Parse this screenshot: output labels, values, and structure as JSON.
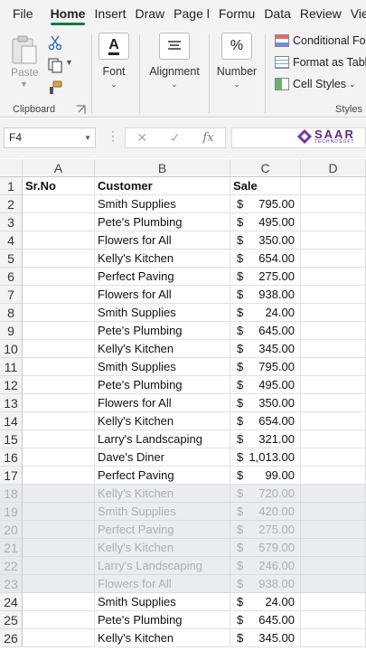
{
  "ribbon_tabs": [
    "File",
    "Home",
    "Insert",
    "Draw",
    "Page l",
    "Formu",
    "Data",
    "Review",
    "View"
  ],
  "active_tab": "Home",
  "clipboard": {
    "paste_label": "Paste",
    "group_label": "Clipboard"
  },
  "font": {
    "label": "Font",
    "icon_glyph": "A"
  },
  "alignment": {
    "label": "Alignment"
  },
  "number": {
    "label": "Number",
    "icon_glyph": "%"
  },
  "styles": {
    "conditional": "Conditional Fo",
    "format_as_table": "Format as Table",
    "cell_styles": "Cell Styles",
    "group_label": "Styles"
  },
  "name_box": "F4",
  "fx_label": "fx",
  "logo": {
    "name": "SAAR",
    "sub": "TECHNOSOFT"
  },
  "columns": [
    "A",
    "B",
    "C",
    "D"
  ],
  "sheet": {
    "header": {
      "row": "1",
      "a": "Sr.No",
      "b": "Customer",
      "c": "Sale"
    },
    "rows": [
      {
        "row": "2",
        "customer": "Smith Supplies",
        "currency": "$",
        "amount": "795.00",
        "dimmed": false
      },
      {
        "row": "3",
        "customer": "Pete's Plumbing",
        "currency": "$",
        "amount": "495.00",
        "dimmed": false
      },
      {
        "row": "4",
        "customer": "Flowers for All",
        "currency": "$",
        "amount": "350.00",
        "dimmed": false
      },
      {
        "row": "5",
        "customer": "Kelly's Kitchen",
        "currency": "$",
        "amount": "654.00",
        "dimmed": false
      },
      {
        "row": "6",
        "customer": "Perfect Paving",
        "currency": "$",
        "amount": "275.00",
        "dimmed": false
      },
      {
        "row": "7",
        "customer": "Flowers for All",
        "currency": "$",
        "amount": "938.00",
        "dimmed": false
      },
      {
        "row": "8",
        "customer": "Smith Supplies",
        "currency": "$",
        "amount": "24.00",
        "dimmed": false
      },
      {
        "row": "9",
        "customer": "Pete's Plumbing",
        "currency": "$",
        "amount": "645.00",
        "dimmed": false
      },
      {
        "row": "10",
        "customer": "Kelly's Kitchen",
        "currency": "$",
        "amount": "345.00",
        "dimmed": false
      },
      {
        "row": "11",
        "customer": "Smith Supplies",
        "currency": "$",
        "amount": "795.00",
        "dimmed": false
      },
      {
        "row": "12",
        "customer": "Pete's Plumbing",
        "currency": "$",
        "amount": "495.00",
        "dimmed": false
      },
      {
        "row": "13",
        "customer": "Flowers for All",
        "currency": "$",
        "amount": "350.00",
        "dimmed": false
      },
      {
        "row": "14",
        "customer": "Kelly's Kitchen",
        "currency": "$",
        "amount": "654.00",
        "dimmed": false
      },
      {
        "row": "15",
        "customer": "Larry's Landscaping",
        "currency": "$",
        "amount": "321.00",
        "dimmed": false
      },
      {
        "row": "16",
        "customer": "Dave's Diner",
        "currency": "$",
        "amount": "1,013.00",
        "dimmed": false
      },
      {
        "row": "17",
        "customer": "Perfect Paving",
        "currency": "$",
        "amount": "99.00",
        "dimmed": false
      },
      {
        "row": "18",
        "customer": "Kelly's Kitchen",
        "currency": "$",
        "amount": "720.00",
        "dimmed": true
      },
      {
        "row": "19",
        "customer": "Smith Supplies",
        "currency": "$",
        "amount": "420.00",
        "dimmed": true
      },
      {
        "row": "20",
        "customer": "Perfect Paving",
        "currency": "$",
        "amount": "275.00",
        "dimmed": true
      },
      {
        "row": "21",
        "customer": "Kelly's Kitchen",
        "currency": "$",
        "amount": "579.00",
        "dimmed": true
      },
      {
        "row": "22",
        "customer": "Larry's Landscaping",
        "currency": "$",
        "amount": "246.00",
        "dimmed": true
      },
      {
        "row": "23",
        "customer": "Flowers for All",
        "currency": "$",
        "amount": "938.00",
        "dimmed": true
      },
      {
        "row": "24",
        "customer": "Smith Supplies",
        "currency": "$",
        "amount": "24.00",
        "dimmed": false
      },
      {
        "row": "25",
        "customer": "Pete's Plumbing",
        "currency": "$",
        "amount": "645.00",
        "dimmed": false
      },
      {
        "row": "26",
        "customer": "Kelly's Kitchen",
        "currency": "$",
        "amount": "345.00",
        "dimmed": false
      }
    ]
  }
}
